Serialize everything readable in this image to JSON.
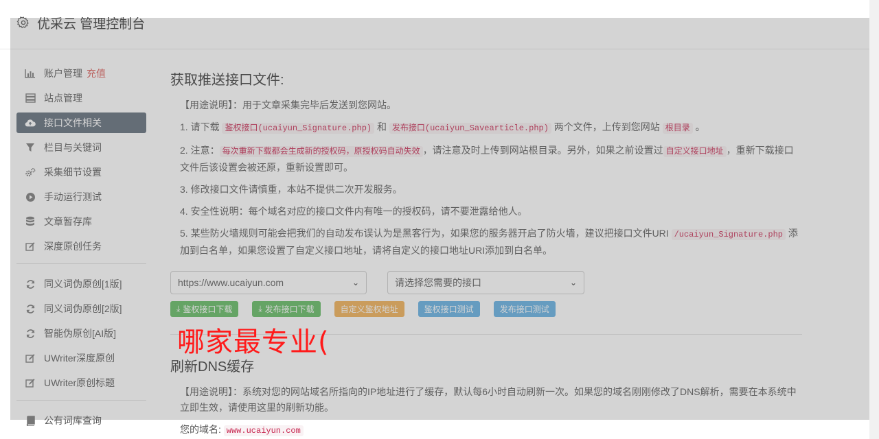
{
  "header": {
    "title": "优采云 管理控制台"
  },
  "sidebar": {
    "items": [
      {
        "label": "账户管理",
        "badge": "充值",
        "icon": "bar-chart-icon"
      },
      {
        "label": "站点管理",
        "icon": "server-icon"
      },
      {
        "label": "接口文件相关",
        "icon": "cloud-upload-icon",
        "active": true
      },
      {
        "label": "栏目与关键词",
        "icon": "filter-icon"
      },
      {
        "label": "采集细节设置",
        "icon": "gears-icon"
      },
      {
        "label": "手动运行测试",
        "icon": "play-circle-icon"
      },
      {
        "label": "文章暂存库",
        "icon": "database-icon"
      },
      {
        "label": "深度原创任务",
        "icon": "edit-icon"
      }
    ],
    "items2": [
      {
        "label": "同义词伪原创[1版]",
        "icon": "refresh-icon"
      },
      {
        "label": "同义词伪原创[2版]",
        "icon": "refresh-icon"
      },
      {
        "label": "智能伪原创[AI版]",
        "icon": "refresh-icon"
      },
      {
        "label": "UWriter深度原创",
        "icon": "edit-icon"
      },
      {
        "label": "UWriter原创标题",
        "icon": "edit-icon"
      }
    ],
    "items3": [
      {
        "label": "公有词库查询",
        "icon": "book-icon"
      }
    ]
  },
  "section1": {
    "title": "获取推送接口文件:",
    "usage_prefix": "【用途说明】：",
    "usage_text": "用于文章采集完毕后发送到您网站。",
    "p1": {
      "a": "1. 请下载 ",
      "c1": "鉴权接口(ucaiyun_Signature.php)",
      "b": " 和 ",
      "c2": "发布接口(ucaiyun_Savearticle.php)",
      "c": " 两个文件，上传到您网站 ",
      "c3": "根目录",
      "d": " 。"
    },
    "p2": {
      "a": "2. 注意：",
      "c1": "每次重新下载都会生成新的授权码，原授权码自动失效",
      "b": "，请注意及时上传到网站根目录。另外，如果之前设置过",
      "c2": "自定义接口地址",
      "c": "，重新下载接口文件后该设置会被还原，重新设置即可。"
    },
    "p3": "3. 修改接口文件请慎重，本站不提供二次开发服务。",
    "p4": "4. 安全性说明：每个域名对应的接口文件内有唯一的授权码，请不要泄露给他人。",
    "p5": {
      "a": "5. 某些防火墙规则可能会把我们的自动发布误认为是黑客行为，如果您的服务器开启了防火墙，建议把接口文件URI ",
      "c1": "/ucaiyun_Signature.php",
      "b": " 添加到白名单，如果您设置了自定义接口地址，请将自定义的接口地址URI添加到白名单。"
    },
    "site_select": "https://www.ucaiyun.com",
    "api_select": "请选择您需要的接口",
    "buttons": [
      "鉴权接口下载",
      "发布接口下载",
      "自定义鉴权地址",
      "鉴权接口测试",
      "发布接口测试"
    ]
  },
  "watermark": "哪家最专业(",
  "section2": {
    "title": "刷新DNS缓存",
    "usage_prefix": "【用途说明】：",
    "usage_text": "系统对您的网站域名所指向的IP地址进行了缓存，默认每6小时自动刷新一次。如果您的域名刚刚修改了DNS解析，需要在本系统中立即生效，请使用这里的刷新功能。",
    "domain_label": "您的域名:",
    "domain_value": "www.ucaiyun.com"
  }
}
